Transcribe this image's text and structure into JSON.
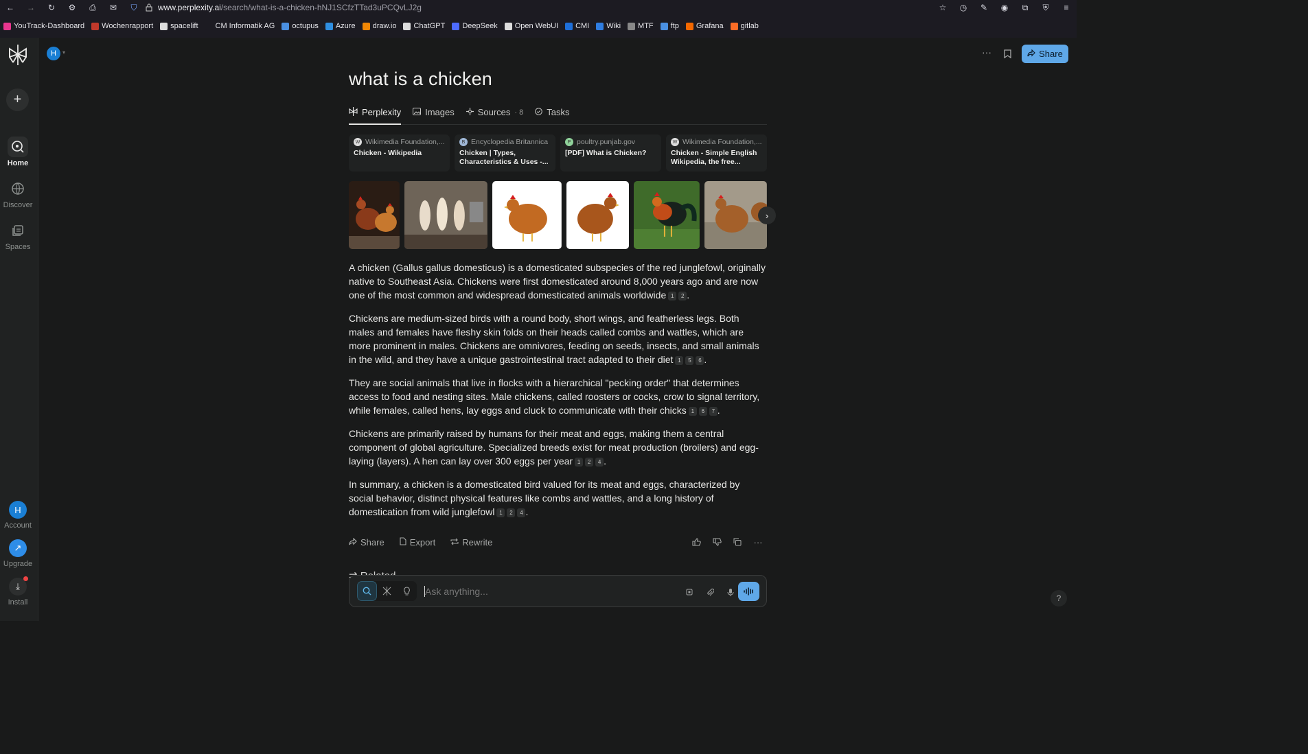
{
  "browser": {
    "url_host": "www.perplexity.ai",
    "url_path": "/search/what-is-a-chicken-hNJ1SCfzTTad3uPCQvLJ2g"
  },
  "bookmarks": [
    {
      "label": "YouTrack-Dashboard",
      "color": "#e9368f"
    },
    {
      "label": "Wochenrapport",
      "color": "#c0392b"
    },
    {
      "label": "spacelift",
      "color": "#dddddd"
    },
    {
      "label": "CM Informatik AG",
      "color": "#1c1b22"
    },
    {
      "label": "octupus",
      "color": "#4a90e2"
    },
    {
      "label": "Azure",
      "color": "#2f8ee0"
    },
    {
      "label": "draw.io",
      "color": "#f08705"
    },
    {
      "label": "ChatGPT",
      "color": "#dddddd"
    },
    {
      "label": "DeepSeek",
      "color": "#4d6bfe"
    },
    {
      "label": "Open WebUI",
      "color": "#dddddd"
    },
    {
      "label": "CMI",
      "color": "#1e6fd9"
    },
    {
      "label": "Wiki",
      "color": "#2f7de1"
    },
    {
      "label": "MTF",
      "color": "#888888"
    },
    {
      "label": "ftp",
      "color": "#4a90e2"
    },
    {
      "label": "Grafana",
      "color": "#f46800"
    },
    {
      "label": "gitlab",
      "color": "#fc6d26"
    }
  ],
  "sidebar": {
    "nav": [
      {
        "label": "Home",
        "icon": "home-search-icon"
      },
      {
        "label": "Discover",
        "icon": "globe-icon"
      },
      {
        "label": "Spaces",
        "icon": "spaces-icon"
      }
    ],
    "account_initial": "H",
    "account_label": "Account",
    "upgrade_label": "Upgrade",
    "install_label": "Install"
  },
  "header": {
    "avatar_initial": "H",
    "share_label": "Share"
  },
  "query": "what is a chicken",
  "tabs": [
    {
      "label": "Perplexity",
      "icon": "perplexity-icon",
      "count": ""
    },
    {
      "label": "Images",
      "icon": "image-icon",
      "count": ""
    },
    {
      "label": "Sources",
      "icon": "sources-icon",
      "count": "· 8"
    },
    {
      "label": "Tasks",
      "icon": "check-circle-icon",
      "count": ""
    }
  ],
  "sources": [
    {
      "site": "Wikimedia Foundation,...",
      "title": "Chicken - Wikipedia",
      "fav": "W",
      "fav_color": "#dddddd"
    },
    {
      "site": "Encyclopedia Britannica",
      "title": "Chicken | Types, Characteristics & Uses -...",
      "fav": "B",
      "fav_color": "#9fb7d6"
    },
    {
      "site": "poultry.punjab.gov",
      "title": "[PDF] What is Chicken?",
      "fav": "P",
      "fav_color": "#8fd29a"
    },
    {
      "site": "Wikimedia Foundation,...",
      "title": "Chicken - Simple English Wikipedia, the free...",
      "fav": "W",
      "fav_color": "#dddddd"
    }
  ],
  "answer": {
    "paragraphs": [
      {
        "text": "A chicken (Gallus gallus domesticus) is a domesticated subspecies of the red junglefowl, originally native to Southeast Asia. Chickens were first domesticated around 8,000 years ago and are now one of the most common and widespread domesticated animals worldwide",
        "cites": [
          "1",
          "2"
        ]
      },
      {
        "text": "Chickens are medium-sized birds with a round body, short wings, and featherless legs. Both males and females have fleshy skin folds on their heads called combs and wattles, which are more prominent in males. Chickens are omnivores, feeding on seeds, insects, and small animals in the wild, and they have a unique gastrointestinal tract adapted to their diet",
        "cites": [
          "1",
          "5",
          "6"
        ]
      },
      {
        "text": "They are social animals that live in flocks with a hierarchical \"pecking order\" that determines access to food and nesting sites. Male chickens, called roosters or cocks, crow to signal territory, while females, called hens, lay eggs and cluck to communicate with their chicks",
        "cites": [
          "1",
          "6",
          "7"
        ]
      },
      {
        "text": "Chickens are primarily raised by humans for their meat and eggs, making them a central component of global agriculture. Specialized breeds exist for meat production (broilers) and egg-laying (layers). A hen can lay over 300 eggs per year",
        "cites": [
          "1",
          "2",
          "4"
        ]
      },
      {
        "text": "In summary, a chicken is a domesticated bird valued for its meat and eggs, characterized by social behavior, distinct physical features like combs and wattles, and a long history of domestication from wild junglefowl",
        "cites": [
          "1",
          "2",
          "4"
        ]
      }
    ]
  },
  "actions": {
    "share": "Share",
    "export": "Export",
    "rewrite": "Rewrite"
  },
  "related_label": "Related",
  "ask": {
    "placeholder": "Ask anything..."
  },
  "help_label": "?",
  "colors": {
    "accent": "#5fa8e8",
    "bg": "#191a1a",
    "sidebar": "#202222"
  }
}
